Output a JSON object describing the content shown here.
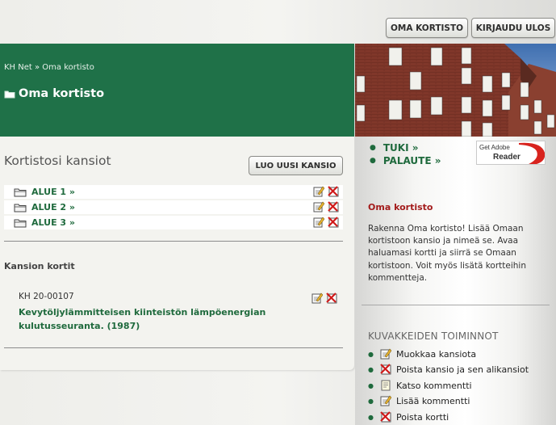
{
  "header": {
    "my_cards_button": "OMA KORTISTO",
    "logout_button": "KIRJAUDU ULOS",
    "breadcrumb": "KH Net » Oma kortisto",
    "page_title": "Oma kortisto"
  },
  "folders": {
    "title": "Kortistosi kansiot",
    "new_folder_button": "LUO UUSI KANSIO",
    "items": [
      {
        "label": "ALUE 1 »"
      },
      {
        "label": "ALUE 2 »"
      },
      {
        "label": "ALUE 3 »"
      }
    ]
  },
  "cards": {
    "title": "Kansion kortit",
    "items": [
      {
        "id": "KH 20-00107",
        "title": "Kevytöljylämmitteisen kiinteistön lämpöenergian kulutusseuranta. (1987)"
      }
    ]
  },
  "sidebar": {
    "links": [
      {
        "label": "TUKI »"
      },
      {
        "label": "PALAUTE »"
      }
    ],
    "adobe": {
      "get": "Get Adobe",
      "reader": "Reader"
    },
    "info_title": "Oma kortisto",
    "info_text": "Rakenna Oma kortisto! Lisää Omaan kortistoon kansio ja nimeä se. Avaa haluamasi kortti ja siirrä se Omaan kortistoon. Voit myös lisätä kortteihin kommentteja.",
    "actions_title": "KUVAKKEIDEN TOIMINNOT",
    "legend": [
      {
        "icon": "edit-icon",
        "label": "Muokkaa kansiota"
      },
      {
        "icon": "delete-icon",
        "label": "Poista kansio ja sen alikansiot"
      },
      {
        "icon": "comment-view-icon",
        "label": "Katso kommentti"
      },
      {
        "icon": "comment-add-icon",
        "label": "Lisää kommentti"
      },
      {
        "icon": "delete-icon",
        "label": "Poista kortti"
      }
    ]
  },
  "colors": {
    "brand_green": "#1f7148",
    "link_green": "#1f6a3d",
    "info_red": "#a31b1b"
  }
}
